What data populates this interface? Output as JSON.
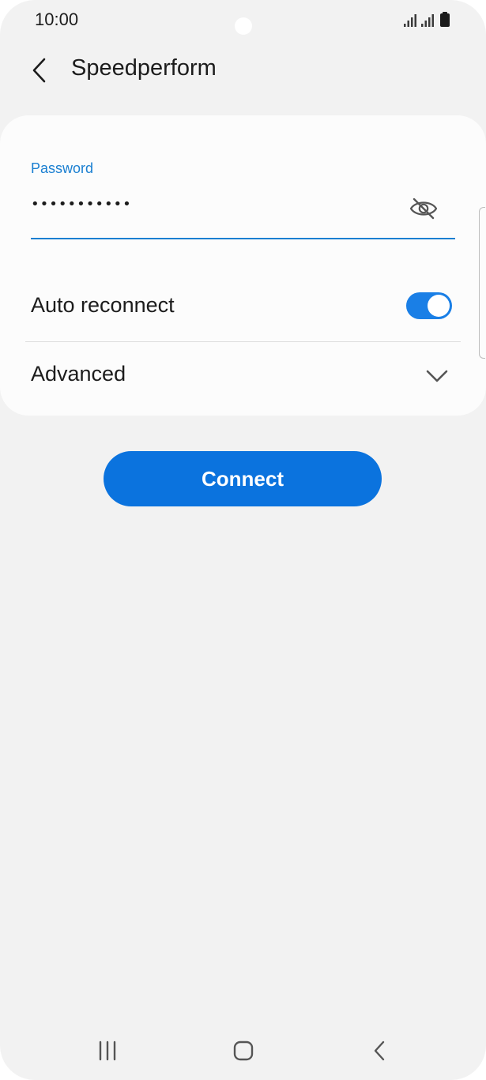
{
  "status_bar": {
    "time": "10:00",
    "icons": [
      "signal-icon",
      "signal-icon",
      "battery-icon"
    ]
  },
  "header": {
    "title": "Speedperform",
    "back_icon": "chevron-left-icon"
  },
  "password": {
    "label": "Password",
    "value": "•••••••••••",
    "toggle_icon": "eye-off-icon"
  },
  "auto_reconnect": {
    "label": "Auto reconnect",
    "enabled": true
  },
  "advanced": {
    "label": "Advanced",
    "icon": "chevron-down-icon"
  },
  "connect_button": {
    "label": "Connect"
  },
  "navigation_bar": {
    "recents_icon": "recents-icon",
    "home_icon": "home-icon",
    "back_icon": "back-icon"
  },
  "colors": {
    "accent": "#1a7fd1",
    "button": "#0b73de",
    "toggle_on": "#1a7fe6",
    "background": "#f2f2f2",
    "card": "#fcfcfc"
  }
}
